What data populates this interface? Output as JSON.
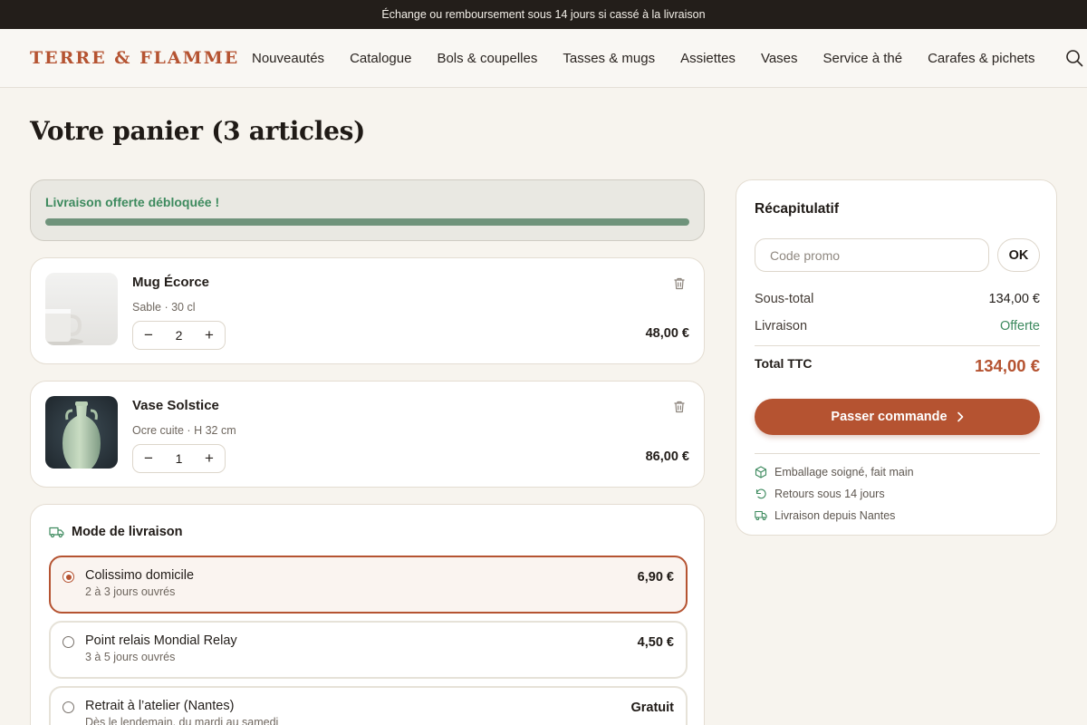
{
  "topbar": {
    "text": "Échange ou remboursement sous 14 jours si cassé à la livraison"
  },
  "brand": {
    "logo": "TERRE & FLAMME",
    "accent": "#b55331",
    "success": "#3d8a5e"
  },
  "nav": {
    "items": [
      "Nouveautés",
      "Catalogue",
      "Bols & coupelles",
      "Tasses & mugs",
      "Assiettes",
      "Vases",
      "Service à thé",
      "Carafes & pichets"
    ],
    "search_icon": "search-icon"
  },
  "page": {
    "title": "Votre panier (3 articles)"
  },
  "shipping_banner": {
    "text": "Livraison offerte débloquée !",
    "progress_percent": 100
  },
  "cart": {
    "items": [
      {
        "name": "Mug Écorce",
        "variant": "Sable · 30 cl",
        "quantity": "2",
        "price": "48,00 €"
      },
      {
        "name": "Vase Solstice",
        "variant": "Ocre cuite · H 32 cm",
        "quantity": "1",
        "price": "86,00 €"
      }
    ]
  },
  "delivery": {
    "title": "Mode de livraison",
    "options": [
      {
        "name": "Colissimo domicile",
        "sub": "2 à 3 jours ouvrés",
        "price": "6,90 €",
        "selected": true
      },
      {
        "name": "Point relais Mondial Relay",
        "sub": "3 à 5 jours ouvrés",
        "price": "4,50 €",
        "selected": false
      },
      {
        "name": "Retrait à l’atelier (Nantes)",
        "sub": "Dès le lendemain, du mardi au samedi",
        "price": "Gratuit",
        "selected": false
      }
    ]
  },
  "summary": {
    "title": "Récapitulatif",
    "promo_placeholder": "Code promo",
    "promo_button": "OK",
    "subtotal_label": "Sous-total",
    "subtotal_value": "134,00 €",
    "shipping_label": "Livraison",
    "shipping_value": "Offerte",
    "total_label": "Total TTC",
    "total_value": "134,00 €",
    "cta": "Passer commande",
    "perks": [
      "Emballage soigné, fait main",
      "Retours sous 14 jours",
      "Livraison depuis Nantes"
    ]
  }
}
